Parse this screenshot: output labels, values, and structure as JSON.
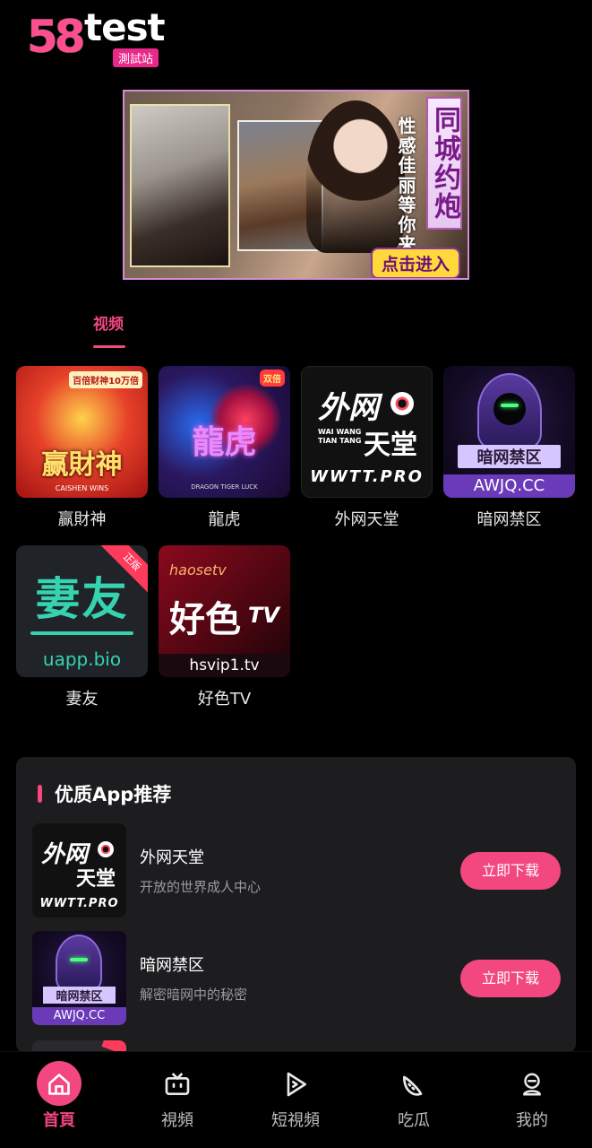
{
  "header": {
    "logo_number": "58",
    "logo_word": "test",
    "logo_sub": "測試站"
  },
  "banner": {
    "vertical_title": "同城约炮",
    "vertical_subtitle": "性感佳丽等你来约",
    "cta": "点击进入"
  },
  "tabs": [
    {
      "label": "视频",
      "active": true
    }
  ],
  "apps": [
    {
      "name": "赢財神",
      "tile_text": "赢財神",
      "badge": "百倍财神10万倍",
      "sub": "CAISHEN WINS"
    },
    {
      "name": "龍虎",
      "tile_text": "龍虎",
      "badge": "双倍",
      "sub": "DRAGON TIGER LUCK"
    },
    {
      "name": "外网天堂",
      "tile_text_1": "外网",
      "tile_text_2": "天堂",
      "small": "WAI WANG TIAN TANG",
      "domain": "WWTT.PRO"
    },
    {
      "name": "暗网禁区",
      "tile_text": "暗网禁区",
      "domain": "AWJQ.CC"
    },
    {
      "name": "妻友",
      "tile_text": "妻友",
      "domain": "uapp.bio",
      "corner": "正版"
    },
    {
      "name": "好色TV",
      "script": "haosetv",
      "tile_text": "好色",
      "tv": "TV",
      "domain": "hsvip1.tv"
    }
  ],
  "recommend": {
    "title": "优质App推荐",
    "items": [
      {
        "name": "外网天堂",
        "desc": "开放的世界成人中心",
        "button": "立即下载",
        "icon_text_1": "外网",
        "icon_text_2": "天堂",
        "icon_domain": "WWTT.PRO"
      },
      {
        "name": "暗网禁区",
        "desc": "解密暗网中的秘密",
        "button": "立即下载",
        "icon_text": "暗网禁区",
        "icon_domain": "AWJQ.CC"
      }
    ]
  },
  "nav": [
    {
      "label": "首頁",
      "icon": "home-icon",
      "active": true
    },
    {
      "label": "視頻",
      "icon": "tv-icon",
      "active": false
    },
    {
      "label": "短視頻",
      "icon": "play-icon",
      "active": false
    },
    {
      "label": "吃瓜",
      "icon": "melon-icon",
      "active": false
    },
    {
      "label": "我的",
      "icon": "profile-icon",
      "active": false
    }
  ],
  "colors": {
    "accent": "#f2477f",
    "background": "#000000",
    "panel": "#1d1d20"
  }
}
